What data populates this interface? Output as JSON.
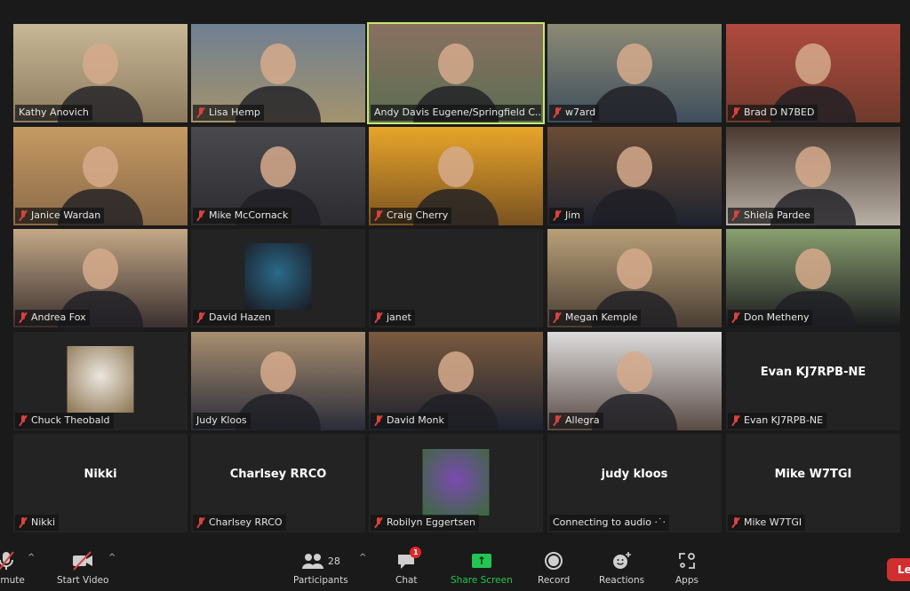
{
  "meeting": {
    "participants": [
      {
        "name": "Kathy Anovich",
        "muted": false,
        "video": true,
        "active_speaker": false,
        "scene": [
          "#c8b896",
          "#8c7a5e"
        ]
      },
      {
        "name": "Lisa Hemp",
        "muted": true,
        "video": true,
        "active_speaker": false,
        "scene": [
          "#6f7f92",
          "#a3936d"
        ]
      },
      {
        "name": "Andy Davis Eugene/Springfield C...",
        "muted": false,
        "video": true,
        "active_speaker": true,
        "scene": [
          "#8a7060",
          "#5b6e52"
        ]
      },
      {
        "name": "w7ard",
        "muted": true,
        "video": true,
        "active_speaker": false,
        "scene": [
          "#8c8a74",
          "#3e4e5c"
        ]
      },
      {
        "name": "Brad D N7BED",
        "muted": true,
        "video": true,
        "active_speaker": false,
        "scene": [
          "#b04a3e",
          "#6e3a2c"
        ]
      },
      {
        "name": "Janice Wardan",
        "muted": true,
        "video": true,
        "active_speaker": false,
        "scene": [
          "#c69a62",
          "#8a6a48"
        ]
      },
      {
        "name": "Mike McCornack",
        "muted": true,
        "video": true,
        "active_speaker": false,
        "scene": [
          "#4a4a4e",
          "#2c2c30"
        ]
      },
      {
        "name": "Craig Cherry",
        "muted": true,
        "video": true,
        "active_speaker": false,
        "scene": [
          "#e8a62a",
          "#7a5220"
        ]
      },
      {
        "name": "Jim",
        "muted": true,
        "video": true,
        "active_speaker": false,
        "scene": [
          "#6a4c34",
          "#1e2230"
        ]
      },
      {
        "name": "Shiela Pardee",
        "muted": true,
        "video": true,
        "active_speaker": false,
        "scene": [
          "#4a3a30",
          "#b8b0a6"
        ]
      },
      {
        "name": "Andrea Fox",
        "muted": true,
        "video": true,
        "active_speaker": false,
        "scene": [
          "#c4a886",
          "#3a3030"
        ]
      },
      {
        "name": "David Hazen",
        "muted": true,
        "video": false,
        "avatar": true,
        "active_speaker": false,
        "scene": [
          "#2a6a8a",
          "#1a1a22"
        ]
      },
      {
        "name": "janet",
        "muted": true,
        "video": false,
        "active_speaker": false
      },
      {
        "name": "Megan Kemple",
        "muted": true,
        "video": true,
        "active_speaker": false,
        "scene": [
          "#b8a078",
          "#4a3e34"
        ]
      },
      {
        "name": "Don Metheny",
        "muted": true,
        "video": true,
        "active_speaker": false,
        "scene": [
          "#8aa070",
          "#1a1a1e"
        ]
      },
      {
        "name": "Chuck Theobald",
        "muted": true,
        "video": false,
        "avatar": true,
        "active_speaker": false,
        "scene": [
          "#ece6de",
          "#8a7450"
        ]
      },
      {
        "name": "Judy Kloos",
        "muted": false,
        "video": true,
        "active_speaker": false,
        "scene": [
          "#a88e6e",
          "#2a2c3a"
        ]
      },
      {
        "name": "David Monk",
        "muted": true,
        "video": true,
        "active_speaker": false,
        "scene": [
          "#7a5a3e",
          "#1e2230"
        ]
      },
      {
        "name": "Allegra",
        "muted": true,
        "video": true,
        "active_speaker": false,
        "scene": [
          "#dcdcdc",
          "#5a4a44"
        ]
      },
      {
        "name": "Evan KJ7RPB-NE",
        "muted": true,
        "video": false,
        "center_label": "Evan KJ7RPB-NE",
        "active_speaker": false
      },
      {
        "name": "Nikki",
        "muted": true,
        "video": false,
        "center_label": "Nikki",
        "active_speaker": false
      },
      {
        "name": "Charlsey RRCO",
        "muted": true,
        "video": false,
        "center_label": "Charlsey RRCO",
        "active_speaker": false
      },
      {
        "name": "Robilyn Eggertsen",
        "muted": true,
        "video": false,
        "avatar": true,
        "active_speaker": false,
        "scene": [
          "#7a4ab0",
          "#3a6a3a"
        ]
      },
      {
        "name": "Connecting to audio ·˙·",
        "muted": false,
        "video": false,
        "center_label": "judy kloos",
        "active_speaker": false
      },
      {
        "name": "Mike W7TGI",
        "muted": true,
        "video": false,
        "center_label": "Mike W7TGI",
        "active_speaker": false
      }
    ]
  },
  "toolbar": {
    "unmute_label": "Unmute",
    "start_video_label": "Start Video",
    "participants_label": "Participants",
    "participants_count": "28",
    "chat_label": "Chat",
    "chat_badge": "1",
    "share_label": "Share Screen",
    "share_arrow": "↑",
    "record_label": "Record",
    "reactions_label": "Reactions",
    "apps_label": "Apps",
    "leave_label": "Leave",
    "caret": "^"
  },
  "colors": {
    "active_speaker": "#c4e86b",
    "muted_red": "#d9423f",
    "share_green": "#23c552",
    "leave_red": "#d02f2f",
    "badge_red": "#e02828"
  }
}
